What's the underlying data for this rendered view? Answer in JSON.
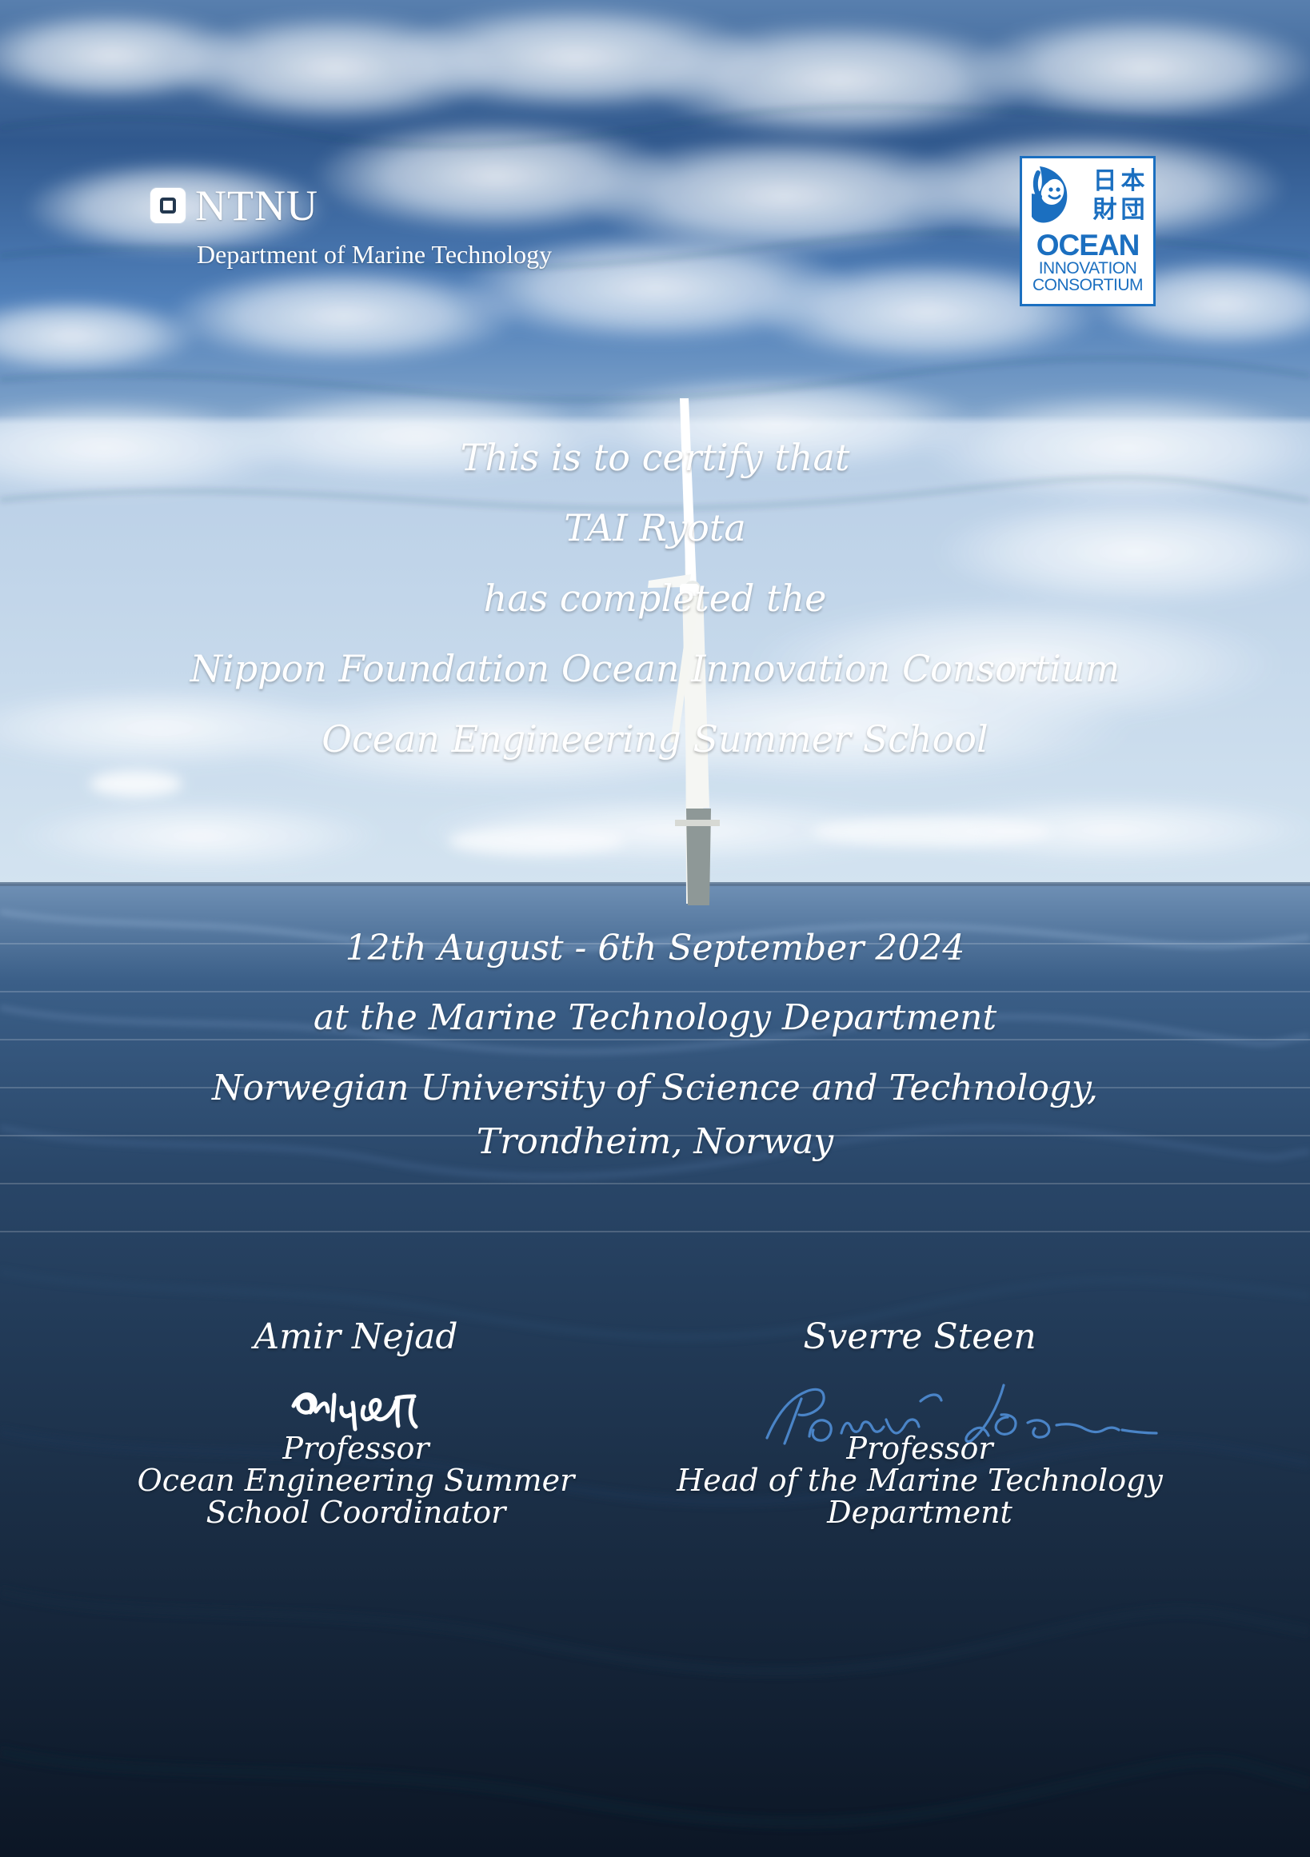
{
  "header": {
    "ntnu_brand": "NTNU",
    "department": "Department of Marine Technology"
  },
  "partner_logo": {
    "kanji": [
      "日",
      "本",
      "財",
      "団"
    ],
    "main": "OCEAN",
    "sub_line_1": "INNOVATION",
    "sub_line_2": "CONSORTIUM"
  },
  "certificate": {
    "line_1": "This is to certify that",
    "recipient": "TAI Ryota",
    "line_3": "has completed the",
    "program_line_1": "Nippon Foundation Ocean Innovation Consortium",
    "program_line_2": "Ocean Engineering Summer School",
    "dates": "12th August - 6th September 2024",
    "location_line_1": "at the Marine Technology Department",
    "location_line_2": "Norwegian University of Science and Technology,",
    "location_line_3": "Trondheim, Norway"
  },
  "signatories": [
    {
      "name": "Amir Nejad",
      "title_line_1": "Professor",
      "title_line_2": "Ocean Engineering Summer",
      "title_line_3": "School Coordinator"
    },
    {
      "name": "Sverre Steen",
      "title_line_1": "Professor",
      "title_line_2": "Head of the Marine Technology",
      "title_line_3": "Department"
    }
  ],
  "colors": {
    "text": "#ffffff",
    "logo_blue": "#1b6fc0",
    "signature_blue": "#4a84c7"
  }
}
